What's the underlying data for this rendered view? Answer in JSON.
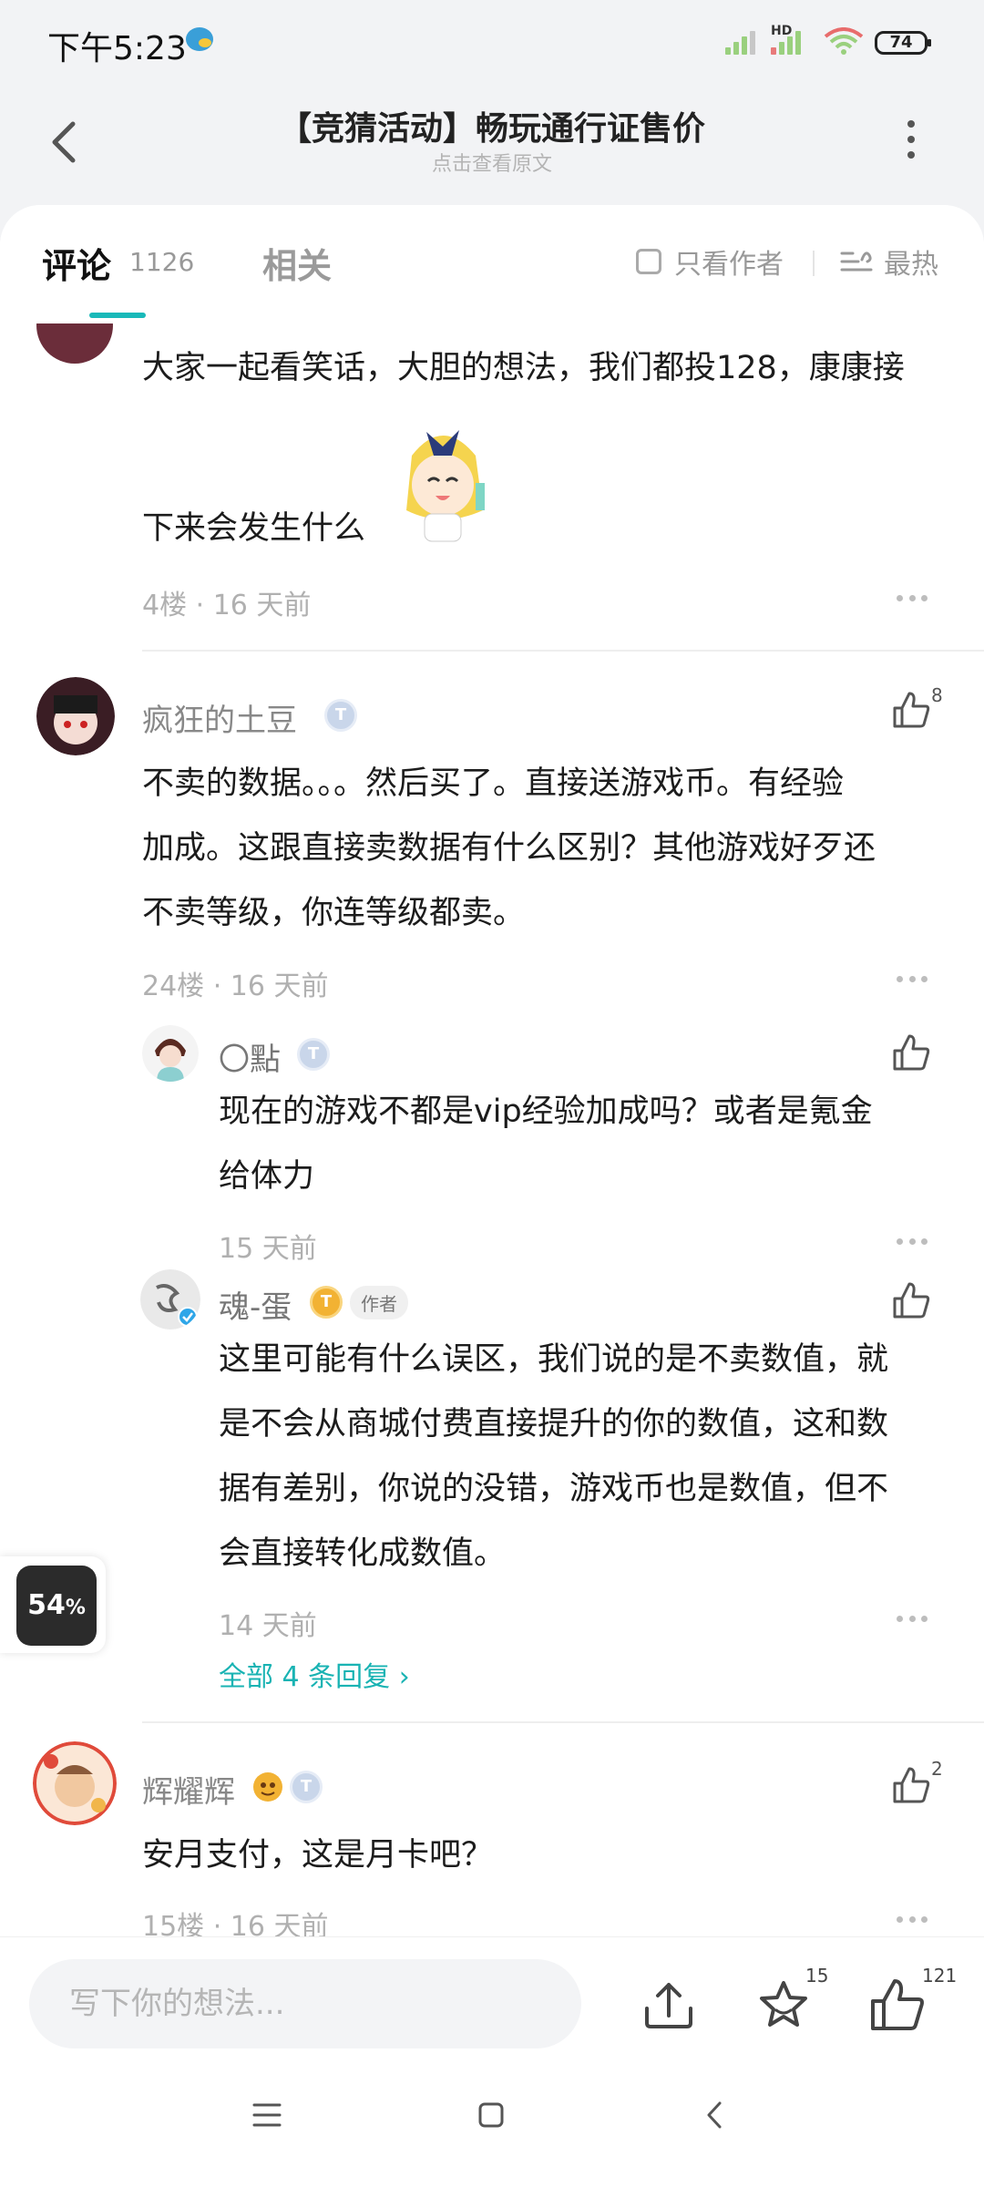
{
  "status_bar": {
    "time": "下午5:23",
    "network": "HD",
    "battery": "74"
  },
  "header": {
    "title": "【竞猜活动】畅玩通行证售价",
    "subtitle": "点击查看原文"
  },
  "tabs": {
    "comments_label": "评论",
    "comments_count": "1126",
    "related_label": "相关",
    "author_only": "只看作者",
    "sort": "最热"
  },
  "comments": [
    {
      "text_line1": "大家一起看笑话，大胆的想法，我们都投128，康康接",
      "text_line2": "下来会发生什么",
      "meta": "4楼 · 16 天前"
    },
    {
      "username": "疯狂的土豆",
      "level": "1",
      "likes": "8",
      "text": [
        "不卖的数据。。。然后买了。直接送游戏币。有经验",
        "加成。这跟直接卖数据有什么区别？其他游戏好歹还",
        "不卖等级，你连等级都卖。"
      ],
      "meta": "24楼 · 16 天前",
      "replies": [
        {
          "username": "〇點",
          "level": "2",
          "text": [
            "现在的游戏不都是vip经验加成吗？或者是氪金",
            "给体力"
          ],
          "meta": "15 天前"
        },
        {
          "username": "魂-蛋",
          "level": "8",
          "author_tag": "作者",
          "text": [
            "这里可能有什么误区，我们说的是不卖数值，就",
            "是不会从商城付费直接提升的你的数值，这和数",
            "据有差别，你说的没错，游戏币也是数值，但不",
            "会直接转化成数值。"
          ],
          "meta": "14 天前"
        }
      ],
      "all_replies": "全部 4 条回复"
    },
    {
      "username": "辉耀辉",
      "level": "1",
      "likes": "2",
      "text": [
        "安月支付，这是月卡吧？"
      ],
      "meta": "15楼 · 16 天前"
    }
  ],
  "float_widget": {
    "percent": "54",
    "unit": "%"
  },
  "bottom_bar": {
    "placeholder": "写下你的想法...",
    "favorites": "15",
    "likes": "121"
  },
  "colors": {
    "accent": "#19b9b9",
    "text": "#1c1c1c",
    "muted": "#b0b0b0"
  }
}
